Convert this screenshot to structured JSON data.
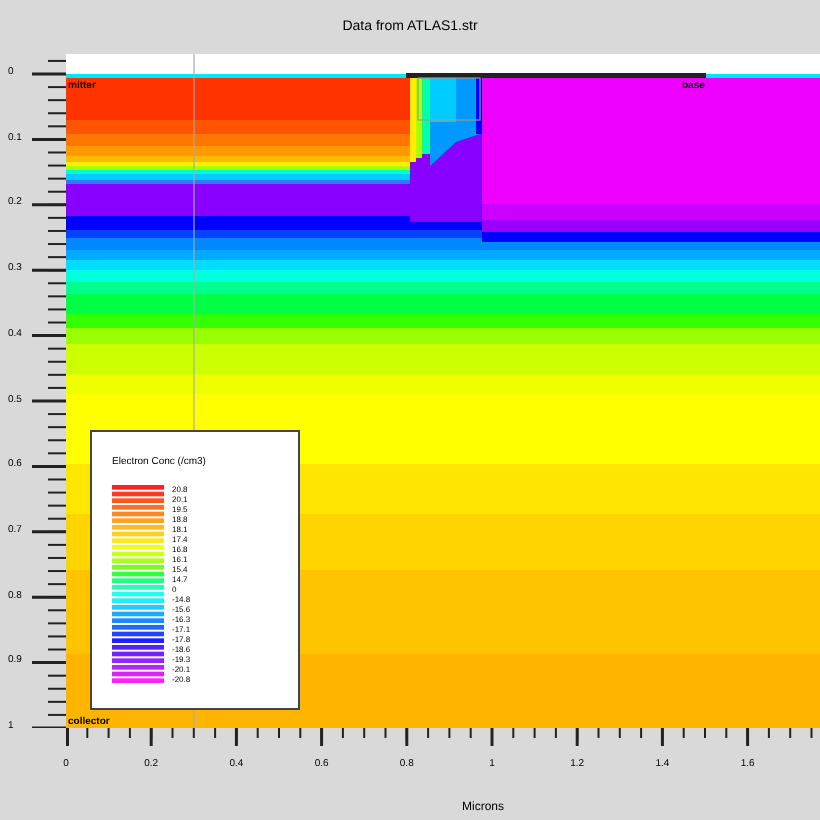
{
  "title": "Data from ATLAS1.str",
  "y_axis": {
    "ticks": [
      "0",
      "0.1",
      "0.2",
      "0.3",
      "0.4",
      "0.5",
      "0.6",
      "0.7",
      "0.8",
      "0.9",
      "1"
    ]
  },
  "x_axis": {
    "ticks": [
      "0",
      "0.2",
      "0.4",
      "0.6",
      "0.8",
      "1",
      "1.2",
      "1.4",
      "1.6"
    ],
    "label": "Microns"
  },
  "region_labels": [
    "mitter",
    "base",
    "collector"
  ],
  "legend": {
    "title": "Electron Conc (/cm3)",
    "labels": [
      "20.8",
      "20.1",
      "19.5",
      "18.8",
      "18.1",
      "17.4",
      "16.8",
      "16.1",
      "15.4",
      "14.7",
      "0",
      "-14.8",
      "-15.6",
      "-16.3",
      "-17.1",
      "-17.8",
      "-18.6",
      "-19.3",
      "-20.1",
      "-20.8"
    ]
  }
}
